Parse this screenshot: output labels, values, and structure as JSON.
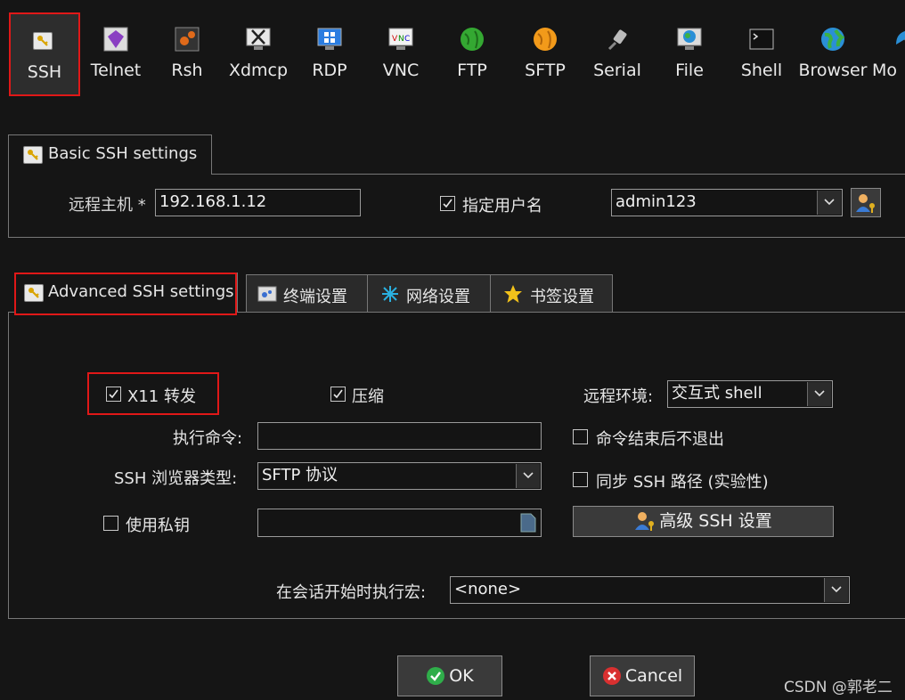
{
  "toolbar": {
    "items": [
      {
        "label": "SSH",
        "icon": "key-icon"
      },
      {
        "label": "Telnet",
        "icon": "gem-icon"
      },
      {
        "label": "Rsh",
        "icon": "gears-icon"
      },
      {
        "label": "Xdmcp",
        "icon": "x-monitor-icon"
      },
      {
        "label": "RDP",
        "icon": "windows-monitor-icon"
      },
      {
        "label": "VNC",
        "icon": "vnc-monitor-icon"
      },
      {
        "label": "FTP",
        "icon": "globe-green-icon"
      },
      {
        "label": "SFTP",
        "icon": "globe-orange-icon"
      },
      {
        "label": "Serial",
        "icon": "plug-icon"
      },
      {
        "label": "File",
        "icon": "globe-monitor-icon"
      },
      {
        "label": "Shell",
        "icon": "terminal-icon"
      },
      {
        "label": "Browser",
        "icon": "globe-icon"
      },
      {
        "label": "Mo",
        "icon": "satellite-icon"
      }
    ]
  },
  "basic": {
    "tab_label": "Basic SSH settings",
    "remote_host_label": "远程主机 *",
    "remote_host_value": "192.168.1.12",
    "specify_user_label": "指定用户名",
    "specify_user_checked": true,
    "username_value": "admin123"
  },
  "advanced": {
    "tabs": [
      {
        "label": "Advanced SSH settings",
        "icon": "key-icon"
      },
      {
        "label": "终端设置",
        "icon": "terminal-settings-icon"
      },
      {
        "label": "网络设置",
        "icon": "network-icon"
      },
      {
        "label": "书签设置",
        "icon": "star-icon"
      }
    ],
    "x11_label": "X11 转发",
    "x11_checked": true,
    "compress_label": "压缩",
    "compress_checked": true,
    "remote_env_label": "远程环境:",
    "remote_env_value": "交互式 shell",
    "exec_cmd_label": "执行命令:",
    "exec_cmd_value": "",
    "no_exit_label": "命令结束后不退出",
    "no_exit_checked": false,
    "browser_type_label": "SSH 浏览器类型:",
    "browser_type_value": "SFTP 协议",
    "sync_path_label": "同步 SSH 路径 (实验性)",
    "sync_path_checked": false,
    "use_key_label": "使用私钥",
    "use_key_checked": false,
    "private_key_value": "",
    "advanced_button_label": "高级 SSH 设置",
    "macro_label": "在会话开始时执行宏:",
    "macro_value": "<none>"
  },
  "buttons": {
    "ok_label": "OK",
    "cancel_label": "Cancel"
  },
  "watermark": "CSDN @郭老二",
  "colors": {
    "background": "#151515",
    "highlight_red": "#e01818",
    "ok_green": "#2fae4a",
    "cancel_red": "#d93030"
  }
}
